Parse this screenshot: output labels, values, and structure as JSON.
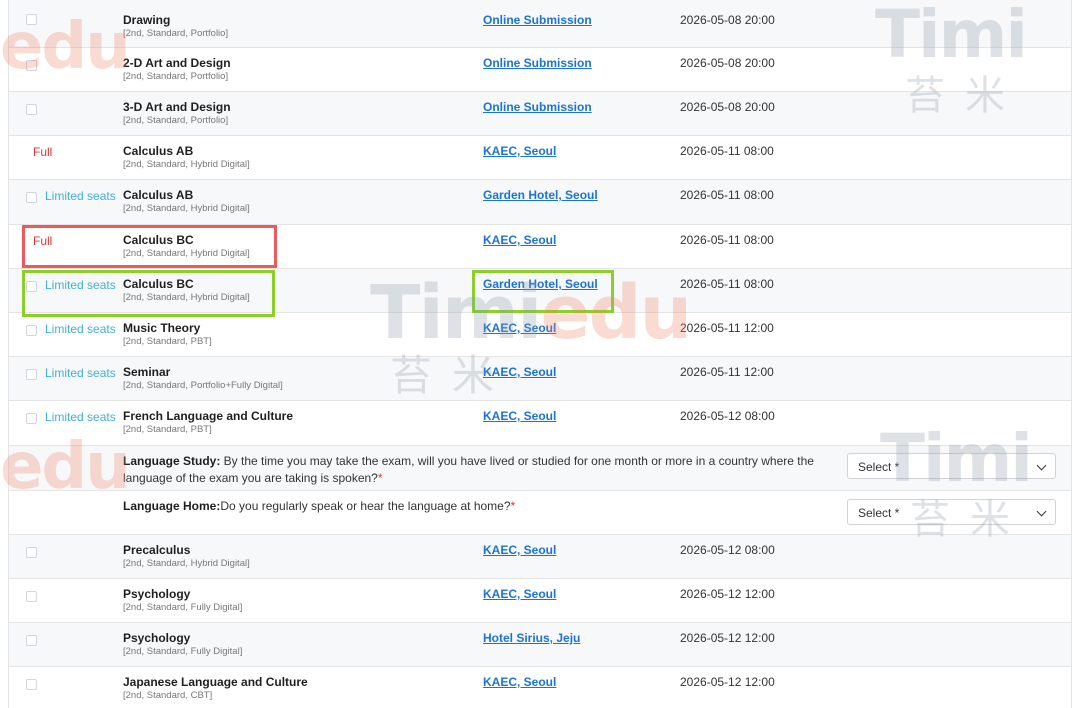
{
  "rows": [
    {
      "status": "",
      "title": "Drawing",
      "meta": "[2nd, Standard, Portfolio]",
      "location": "Online Submission",
      "date": "2026-05-08 20:00"
    },
    {
      "status": "",
      "title": "2-D Art and Design",
      "meta": "[2nd, Standard, Portfolio]",
      "location": "Online Submission",
      "date": "2026-05-08 20:00"
    },
    {
      "status": "",
      "title": "3-D Art and Design",
      "meta": "[2nd, Standard, Portfolio]",
      "location": "Online Submission",
      "date": "2026-05-08 20:00"
    },
    {
      "status": "Full",
      "title": "Calculus AB",
      "meta": "[2nd, Standard, Hybrid Digital]",
      "location": "KAEC, Seoul",
      "date": "2026-05-11 08:00"
    },
    {
      "status": "Limited seats",
      "title": "Calculus AB",
      "meta": "[2nd, Standard, Hybrid Digital]",
      "location": "Garden Hotel, Seoul",
      "date": "2026-05-11 08:00"
    },
    {
      "status": "Full",
      "title": "Calculus BC",
      "meta": "[2nd, Standard, Hybrid Digital]",
      "location": "KAEC, Seoul",
      "date": "2026-05-11 08:00"
    },
    {
      "status": "Limited seats",
      "title": "Calculus BC",
      "meta": "[2nd, Standard, Hybrid Digital]",
      "location": "Garden Hotel, Seoul",
      "date": "2026-05-11 08:00"
    },
    {
      "status": "Limited seats",
      "title": "Music Theory",
      "meta": "[2nd, Standard, PBT]",
      "location": "KAEC, Seoul",
      "date": "2026-05-11 12:00"
    },
    {
      "status": "Limited seats",
      "title": "Seminar",
      "meta": "[2nd, Standard, Portfolio+Fully Digital]",
      "location": "KAEC, Seoul",
      "date": "2026-05-11 12:00"
    },
    {
      "status": "Limited seats",
      "title": "French Language and Culture",
      "meta": "[2nd, Standard, PBT]",
      "location": "KAEC, Seoul",
      "date": "2026-05-12 08:00"
    },
    {
      "status": "",
      "title": "Precalculus",
      "meta": "[2nd, Standard, Hybrid Digital]",
      "location": "KAEC, Seoul",
      "date": "2026-05-12 08:00"
    },
    {
      "status": "",
      "title": "Psychology",
      "meta": "[2nd, Standard, Fully Digital]",
      "location": "KAEC, Seoul",
      "date": "2026-05-12 12:00"
    },
    {
      "status": "",
      "title": "Psychology",
      "meta": "[2nd, Standard, Fully Digital]",
      "location": "Hotel Sirius, Jeju",
      "date": "2026-05-12 12:00"
    },
    {
      "status": "",
      "title": "Japanese Language and Culture",
      "meta": "[2nd, Standard, CBT]",
      "location": "KAEC, Seoul",
      "date": "2026-05-12 12:00"
    }
  ],
  "questions": {
    "language_study": {
      "label": "Language Study:",
      "text": " By the time you may take the exam, will you have lived or studied for one month or more in a country where the language of the exam you are taking is spoken?",
      "required": "*",
      "select": "Select *"
    },
    "language_home": {
      "label": "Language Home:",
      "text": "Do you regularly speak or hear the language at home?",
      "required": "*",
      "select": "Select *"
    }
  },
  "watermark": {
    "brand_a": "Timi",
    "brand_b": "edu",
    "cn": "苔米"
  },
  "colors": {
    "full": "#e0332f",
    "limited": "#3fb0d8",
    "link": "#1a73d9",
    "highlight_red": "#ee5a5a",
    "highlight_green": "#8ccf28"
  }
}
